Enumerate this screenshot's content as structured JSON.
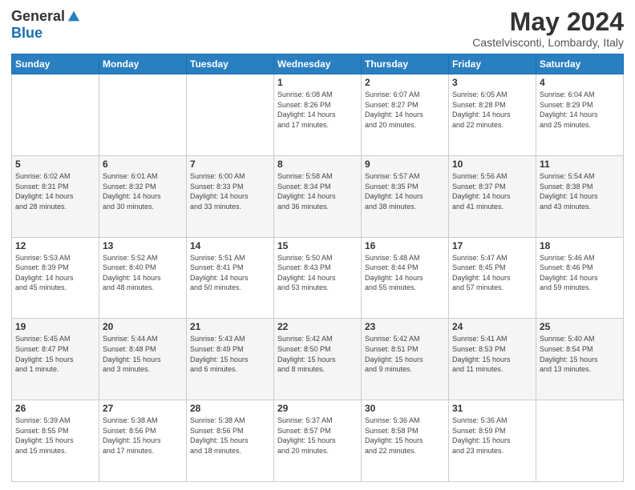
{
  "header": {
    "logo_general": "General",
    "logo_blue": "Blue",
    "main_title": "May 2024",
    "sub_title": "Castelvisconti, Lombardy, Italy"
  },
  "calendar": {
    "days_of_week": [
      "Sunday",
      "Monday",
      "Tuesday",
      "Wednesday",
      "Thursday",
      "Friday",
      "Saturday"
    ],
    "weeks": [
      [
        {
          "day": "",
          "info": ""
        },
        {
          "day": "",
          "info": ""
        },
        {
          "day": "",
          "info": ""
        },
        {
          "day": "1",
          "info": "Sunrise: 6:08 AM\nSunset: 8:26 PM\nDaylight: 14 hours\nand 17 minutes."
        },
        {
          "day": "2",
          "info": "Sunrise: 6:07 AM\nSunset: 8:27 PM\nDaylight: 14 hours\nand 20 minutes."
        },
        {
          "day": "3",
          "info": "Sunrise: 6:05 AM\nSunset: 8:28 PM\nDaylight: 14 hours\nand 22 minutes."
        },
        {
          "day": "4",
          "info": "Sunrise: 6:04 AM\nSunset: 8:29 PM\nDaylight: 14 hours\nand 25 minutes."
        }
      ],
      [
        {
          "day": "5",
          "info": "Sunrise: 6:02 AM\nSunset: 8:31 PM\nDaylight: 14 hours\nand 28 minutes."
        },
        {
          "day": "6",
          "info": "Sunrise: 6:01 AM\nSunset: 8:32 PM\nDaylight: 14 hours\nand 30 minutes."
        },
        {
          "day": "7",
          "info": "Sunrise: 6:00 AM\nSunset: 8:33 PM\nDaylight: 14 hours\nand 33 minutes."
        },
        {
          "day": "8",
          "info": "Sunrise: 5:58 AM\nSunset: 8:34 PM\nDaylight: 14 hours\nand 36 minutes."
        },
        {
          "day": "9",
          "info": "Sunrise: 5:57 AM\nSunset: 8:35 PM\nDaylight: 14 hours\nand 38 minutes."
        },
        {
          "day": "10",
          "info": "Sunrise: 5:56 AM\nSunset: 8:37 PM\nDaylight: 14 hours\nand 41 minutes."
        },
        {
          "day": "11",
          "info": "Sunrise: 5:54 AM\nSunset: 8:38 PM\nDaylight: 14 hours\nand 43 minutes."
        }
      ],
      [
        {
          "day": "12",
          "info": "Sunrise: 5:53 AM\nSunset: 8:39 PM\nDaylight: 14 hours\nand 45 minutes."
        },
        {
          "day": "13",
          "info": "Sunrise: 5:52 AM\nSunset: 8:40 PM\nDaylight: 14 hours\nand 48 minutes."
        },
        {
          "day": "14",
          "info": "Sunrise: 5:51 AM\nSunset: 8:41 PM\nDaylight: 14 hours\nand 50 minutes."
        },
        {
          "day": "15",
          "info": "Sunrise: 5:50 AM\nSunset: 8:43 PM\nDaylight: 14 hours\nand 53 minutes."
        },
        {
          "day": "16",
          "info": "Sunrise: 5:48 AM\nSunset: 8:44 PM\nDaylight: 14 hours\nand 55 minutes."
        },
        {
          "day": "17",
          "info": "Sunrise: 5:47 AM\nSunset: 8:45 PM\nDaylight: 14 hours\nand 57 minutes."
        },
        {
          "day": "18",
          "info": "Sunrise: 5:46 AM\nSunset: 8:46 PM\nDaylight: 14 hours\nand 59 minutes."
        }
      ],
      [
        {
          "day": "19",
          "info": "Sunrise: 5:45 AM\nSunset: 8:47 PM\nDaylight: 15 hours\nand 1 minute."
        },
        {
          "day": "20",
          "info": "Sunrise: 5:44 AM\nSunset: 8:48 PM\nDaylight: 15 hours\nand 3 minutes."
        },
        {
          "day": "21",
          "info": "Sunrise: 5:43 AM\nSunset: 8:49 PM\nDaylight: 15 hours\nand 6 minutes."
        },
        {
          "day": "22",
          "info": "Sunrise: 5:42 AM\nSunset: 8:50 PM\nDaylight: 15 hours\nand 8 minutes."
        },
        {
          "day": "23",
          "info": "Sunrise: 5:42 AM\nSunset: 8:51 PM\nDaylight: 15 hours\nand 9 minutes."
        },
        {
          "day": "24",
          "info": "Sunrise: 5:41 AM\nSunset: 8:53 PM\nDaylight: 15 hours\nand 11 minutes."
        },
        {
          "day": "25",
          "info": "Sunrise: 5:40 AM\nSunset: 8:54 PM\nDaylight: 15 hours\nand 13 minutes."
        }
      ],
      [
        {
          "day": "26",
          "info": "Sunrise: 5:39 AM\nSunset: 8:55 PM\nDaylight: 15 hours\nand 15 minutes."
        },
        {
          "day": "27",
          "info": "Sunrise: 5:38 AM\nSunset: 8:56 PM\nDaylight: 15 hours\nand 17 minutes."
        },
        {
          "day": "28",
          "info": "Sunrise: 5:38 AM\nSunset: 8:56 PM\nDaylight: 15 hours\nand 18 minutes."
        },
        {
          "day": "29",
          "info": "Sunrise: 5:37 AM\nSunset: 8:57 PM\nDaylight: 15 hours\nand 20 minutes."
        },
        {
          "day": "30",
          "info": "Sunrise: 5:36 AM\nSunset: 8:58 PM\nDaylight: 15 hours\nand 22 minutes."
        },
        {
          "day": "31",
          "info": "Sunrise: 5:36 AM\nSunset: 8:59 PM\nDaylight: 15 hours\nand 23 minutes."
        },
        {
          "day": "",
          "info": ""
        }
      ]
    ]
  }
}
